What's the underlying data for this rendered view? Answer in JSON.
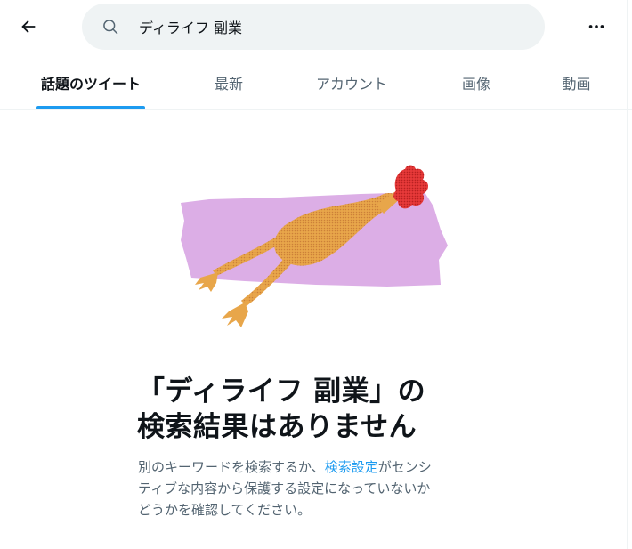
{
  "header": {
    "back_icon": "arrow-left-icon",
    "search": {
      "icon": "search-icon",
      "value": "ディライフ 副業"
    },
    "more_icon": "more-horizontal-icon"
  },
  "tabs": [
    {
      "label": "話題のツイート",
      "active": true
    },
    {
      "label": "最新",
      "active": false
    },
    {
      "label": "アカウント",
      "active": false
    },
    {
      "label": "画像",
      "active": false
    },
    {
      "label": "動画",
      "active": false
    }
  ],
  "empty_state": {
    "illustration": "rubber-chicken-on-purple-paint-stroke",
    "title_line1": "「ディライフ 副業」の",
    "title_line2": "検索結果はありません",
    "desc_before": "別のキーワードを検索するか、",
    "desc_link": "検索設定",
    "desc_after_line1": "がセンシ",
    "desc_line2": "ティブな内容から保護する設定になっていないか",
    "desc_line3": "どうかを確認してください。"
  },
  "colors": {
    "accent": "#1d9bf0",
    "text_primary": "#0f1419",
    "text_secondary": "#536471",
    "search_bg": "#eff3f4",
    "illustration_bg": "#dcaee6",
    "chicken_body": "#e8a64a",
    "comb": "#e83a3a"
  }
}
